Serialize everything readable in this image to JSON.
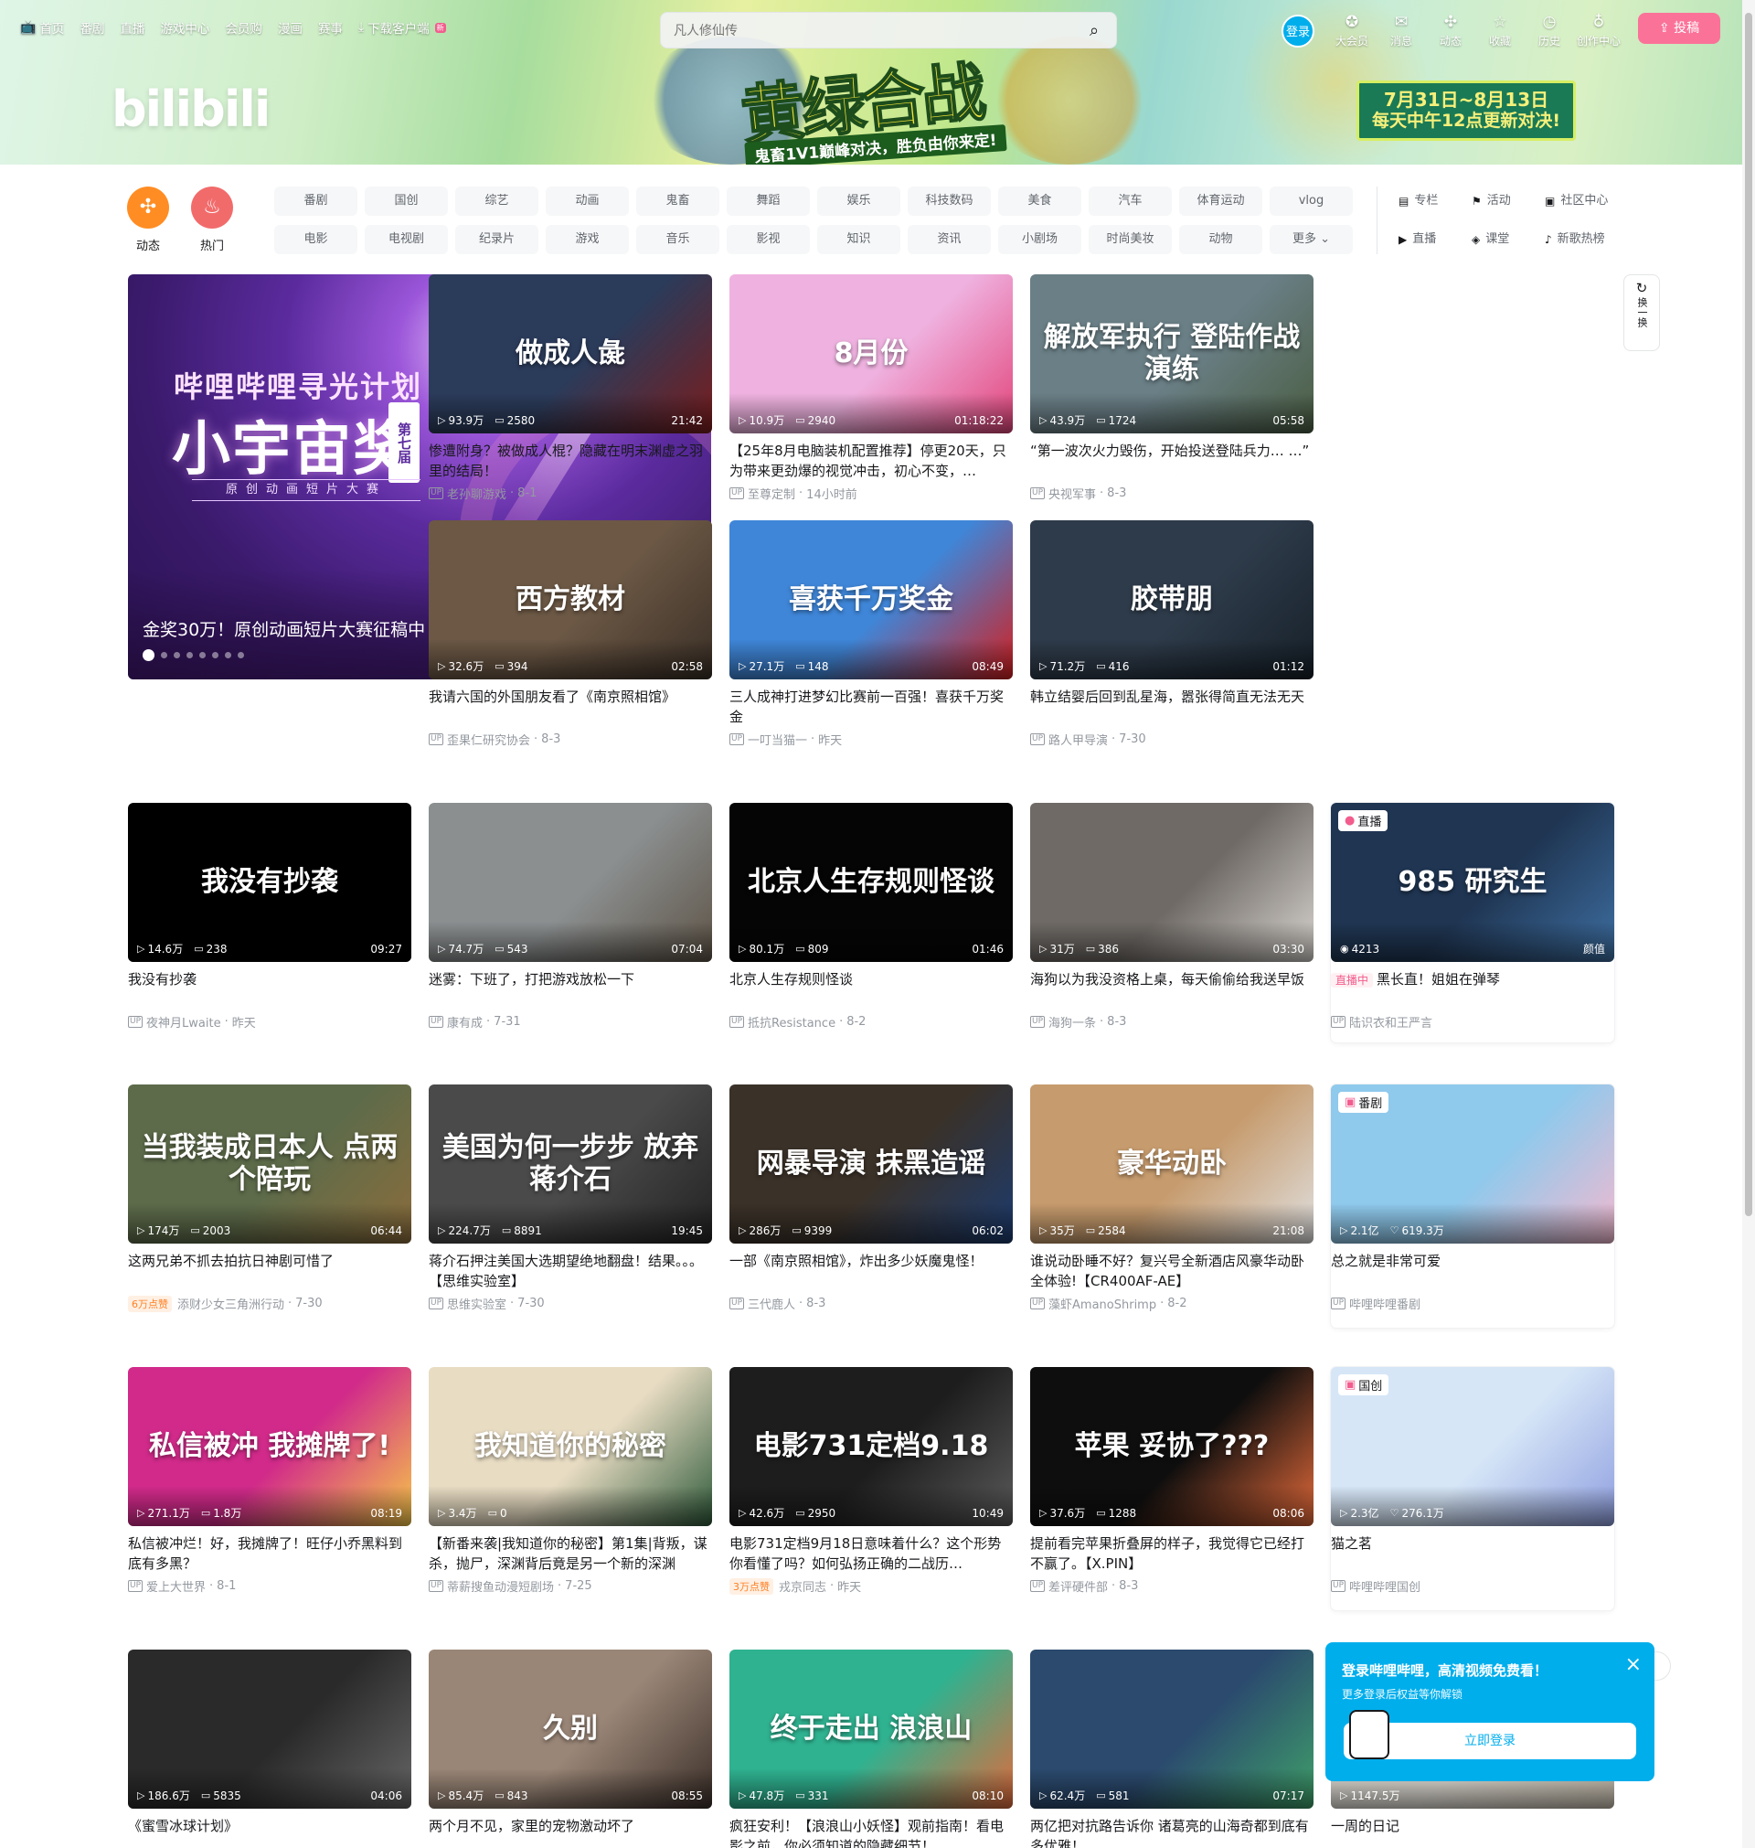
{
  "topnav": [
    {
      "label": "首页",
      "icon": "tv-icon"
    },
    {
      "label": "番剧"
    },
    {
      "label": "直播"
    },
    {
      "label": "游戏中心"
    },
    {
      "label": "会员购"
    },
    {
      "label": "漫画"
    },
    {
      "label": "赛事"
    },
    {
      "label": "下载客户端",
      "icon": "download-icon",
      "badge": "新"
    }
  ],
  "search": {
    "placeholder": "凡人修仙传"
  },
  "login_label": "登录",
  "rightnav": [
    {
      "label": "大会员",
      "icon": "vip-icon"
    },
    {
      "label": "消息",
      "icon": "message-icon"
    },
    {
      "label": "动态",
      "icon": "dynamic-icon"
    },
    {
      "label": "收藏",
      "icon": "star-icon"
    },
    {
      "label": "历史",
      "icon": "clock-icon"
    },
    {
      "label": "创作中心",
      "icon": "bulb-icon"
    }
  ],
  "upload_label": "投稿",
  "banner": {
    "logo": "bilibili",
    "art_title": "黄绿合战",
    "art_sub": "鬼畜1V1巅峰对决，胜负由你来定!",
    "date1": "7月31日~8月13日",
    "date2": "每天中午12点更新对决!"
  },
  "circle_buttons": [
    {
      "label": "动态",
      "color": "#ff8d23"
    },
    {
      "label": "热门",
      "color": "#f26b6b"
    }
  ],
  "channels": [
    "番剧",
    "国创",
    "综艺",
    "动画",
    "鬼畜",
    "舞蹈",
    "娱乐",
    "科技数码",
    "美食",
    "汽车",
    "体育运动",
    "vlog",
    "电影",
    "电视剧",
    "纪录片",
    "游戏",
    "音乐",
    "影视",
    "知识",
    "资讯",
    "小剧场",
    "时尚美妆",
    "动物",
    "更多"
  ],
  "channels_right": [
    {
      "label": "专栏"
    },
    {
      "label": "活动"
    },
    {
      "label": "社区中心"
    },
    {
      "label": "直播"
    },
    {
      "label": "课堂"
    },
    {
      "label": "新歌热榜"
    }
  ],
  "hero": {
    "line1": "哔哩哔哩寻光计划",
    "line2": "小宇宙奖",
    "edition": "第七届",
    "line3": "原创动画短片大赛",
    "caption": "金奖30万！原创动画短片大赛征稿中",
    "dots": 8
  },
  "refresh_label": "换一换",
  "cards": [
    {
      "title": "惨遭附身？被做成人棍？隐藏在明末渊虚之羽里的结局！",
      "views": "93.9万",
      "danmaku": "2580",
      "dur": "21:42",
      "up": "老孙聊游戏",
      "date": "8-1",
      "thumb_text": "做成人彘",
      "bg": "#2b3b5a",
      "accent": "#7a1d1d"
    },
    {
      "title": "【25年8月电脑装机配置推荐】停更20天，只为带来更劲爆的视觉冲击，初心不变，…",
      "views": "10.9万",
      "danmaku": "2940",
      "dur": "01:18:22",
      "up": "至尊定制",
      "date": "14小时前",
      "thumb_text": "8月份",
      "bg": "#efb2e0",
      "accent": "#e2447a"
    },
    {
      "title": "“第一波次火力毁伤，开始投送登陆兵力…\n…”",
      "views": "43.9万",
      "danmaku": "1724",
      "dur": "05:58",
      "up": "央视军事",
      "date": "8-3",
      "thumb_text": "解放军执行 登陆作战演练",
      "bg": "#6a7f86",
      "accent": "#4a5d42"
    },
    {
      "title": "我请六国的外国朋友看了《南京照相馆》",
      "views": "32.6万",
      "danmaku": "394",
      "dur": "02:58",
      "up": "歪果仁研究协会",
      "date": "8-3",
      "thumb_text": "西方教材",
      "bg": "#6c5845",
      "accent": "#3a2f26"
    },
    {
      "title": "三人成神打进梦幻比赛前一百强！喜获千万奖金",
      "views": "27.1万",
      "danmaku": "148",
      "dur": "08:49",
      "up": "一叮当猫一",
      "date": "昨天",
      "thumb_text": "喜获千万奖金",
      "bg": "#3f86d8",
      "accent": "#d41f1f"
    },
    {
      "title": "韩立结婴后回到乱星海，嚣张得简直无法无天",
      "views": "71.2万",
      "danmaku": "416",
      "dur": "01:12",
      "up": "路人甲导演",
      "date": "7-30",
      "thumb_text": "胶带朋",
      "bg": "#2e3b4a",
      "accent": "#162029"
    },
    {
      "title": "我没有抄袭",
      "views": "14.6万",
      "danmaku": "238",
      "dur": "09:27",
      "up": "夜神月Lwaite",
      "date": "昨天",
      "thumb_text": "我没有抄袭",
      "bg": "#000000",
      "accent": "#000000"
    },
    {
      "title": "迷雾：下班了，打把游戏放松一下",
      "views": "74.7万",
      "danmaku": "543",
      "dur": "07:04",
      "up": "康有成",
      "date": "7-31",
      "thumb_text": "",
      "bg": "#8b8f90",
      "accent": "#5e5447"
    },
    {
      "title": "北京人生存规则怪谈",
      "views": "80.1万",
      "danmaku": "809",
      "dur": "01:46",
      "up": "抵抗Resistance",
      "date": "8-2",
      "thumb_text": "北京人生存规则怪谈",
      "bg": "#050505",
      "accent": "#050505"
    },
    {
      "title": "海狗以为我没资格上桌，每天偷偷给我送早饭",
      "views": "31万",
      "danmaku": "386",
      "dur": "03:30",
      "up": "海狗一条",
      "date": "8-3",
      "thumb_text": "",
      "bg": "#6f6a66",
      "accent": "#d8d4cf"
    },
    {
      "title": "黑长直！姐姐在弹琴",
      "views": "4213",
      "danmaku": "",
      "dur": "颜值",
      "up": "陆识衣和王严言",
      "date": "",
      "thumb_text": "985 研究生",
      "bg": "#1f3552",
      "accent": "#3e6fa2",
      "badge": "直播",
      "live": true
    },
    {
      "title": "这两兄弟不抓去拍抗日神剧可惜了",
      "views": "174万",
      "danmaku": "2003",
      "dur": "06:44",
      "up": "添财少女三角洲行动",
      "date": "7-30",
      "thumb_text": "当我装成日本人 点两个陪玩",
      "bg": "#5d6b4a",
      "accent": "#8b6d3c",
      "hot": "6万点赞"
    },
    {
      "title": "蒋介石押注美国大选期望绝地翻盘！结果。。。【思维实验室】",
      "views": "224.7万",
      "danmaku": "8891",
      "dur": "19:45",
      "up": "思维实验室",
      "date": "7-30",
      "thumb_text": "美国为何一步步 放弃蒋介石",
      "bg": "#4a4a4a",
      "accent": "#222222"
    },
    {
      "title": "一部《南京照相馆》，炸出多少妖魔鬼怪！",
      "views": "286万",
      "danmaku": "9399",
      "dur": "06:02",
      "up": "三代鹿人",
      "date": "8-3",
      "thumb_text": "网暴导演 抹黑造谣",
      "bg": "#3a3128",
      "accent": "#1c3b6e"
    },
    {
      "title": "谁说动卧睡不好？复兴号全新酒店风豪华动卧全体验!【CR400AF-AE】",
      "views": "35万",
      "danmaku": "2584",
      "dur": "21:08",
      "up": "藻虾AmanoShrimp",
      "date": "8-2",
      "thumb_text": "豪华动卧",
      "bg": "#c69b6d",
      "accent": "#e0e0e0"
    },
    {
      "title": "总之就是非常可爱",
      "views": "2.1亿",
      "danmaku": "619.3万",
      "dur": "",
      "up": "哔哩哔哩番剧",
      "date": "",
      "thumb_text": "",
      "bg": "#8fc9ec",
      "accent": "#f3b9cf",
      "badge": "番剧",
      "like": true
    },
    {
      "title": "私信被冲烂！好，我摊牌了！旺仔小乔黑料到底有多黑？",
      "views": "271.1万",
      "danmaku": "1.8万",
      "dur": "08:19",
      "up": "爱上大世界",
      "date": "8-1",
      "thumb_text": "私信被冲 我摊牌了!",
      "bg": "#d12a8a",
      "accent": "#f7c948"
    },
    {
      "title": "【新番来袭|我知道你的秘密】第1集|背叛，谋杀，抛尸，深渊背后竟是另一个新的深渊",
      "views": "3.4万",
      "danmaku": "0",
      "dur": "",
      "up": "蒂薪搜鱼动漫短剧场",
      "date": "7-25",
      "thumb_text": "我知道你的秘密",
      "bg": "#e8dcc3",
      "accent": "#2f5a3a"
    },
    {
      "title": "电影731定档9月18日意味着什么？这个形势你看懂了吗？如何弘扬正确的二战历…",
      "views": "42.6万",
      "danmaku": "2950",
      "dur": "10:49",
      "up": "戎京同志",
      "date": "昨天",
      "thumb_text": "电影731定档9.18",
      "bg": "#1d1d1d",
      "accent": "#5a5a5a",
      "hot": "3万点赞"
    },
    {
      "title": "提前看完苹果折叠屏的样子，我觉得它已经打不赢了。【X.PIN】",
      "views": "37.6万",
      "danmaku": "1288",
      "dur": "08:06",
      "up": "差评硬件部",
      "date": "8-3",
      "thumb_text": "苹果 妥协了???",
      "bg": "#0e0e0e",
      "accent": "#e46a3a"
    },
    {
      "title": "猫之茗",
      "views": "2.3亿",
      "danmaku": "276.1万",
      "dur": "",
      "up": "哔哩哔哩国创",
      "date": "",
      "thumb_text": "",
      "bg": "#d6e6f7",
      "accent": "#8f9fe0",
      "badge": "国创",
      "like": true
    },
    {
      "title": "《蜜雪冰球计划》",
      "views": "186.6万",
      "danmaku": "5835",
      "dur": "04:06",
      "up": "",
      "date": "",
      "thumb_text": "",
      "bg": "#2a2a2a",
      "accent": "#666666"
    },
    {
      "title": "两个月不见，家里的宠物激动坏了",
      "views": "85.4万",
      "danmaku": "843",
      "dur": "08:55",
      "up": "",
      "date": "",
      "thumb_text": "久别",
      "bg": "#9a8677",
      "accent": "#3b2f29"
    },
    {
      "title": "疯狂安利！【浪浪山小妖怪】观前指南！看电影之前，你必须知道的隐藏细节！",
      "views": "47.8万",
      "danmaku": "331",
      "dur": "08:10",
      "up": "",
      "date": "",
      "thumb_text": "终于走出 浪浪山",
      "bg": "#2fb290",
      "accent": "#e26a3b"
    },
    {
      "title": "两亿把对抗路告诉你 诸葛亮的山海奇都到底有多优雅！",
      "views": "62.4万",
      "danmaku": "581",
      "dur": "07:17",
      "up": "",
      "date": "",
      "thumb_text": "",
      "bg": "#2b4a6e",
      "accent": "#3fa06a"
    },
    {
      "title": "一周的日记",
      "views": "1147.5万",
      "danmaku": "",
      "dur": "",
      "up": "",
      "date": "",
      "thumb_text": "",
      "bg": "#e8e4dc",
      "accent": "#c9c0b0"
    }
  ],
  "popup": {
    "title": "登录哔哩哔哩，高清视频免费看！",
    "sub": "更多登录后权益等你解锁",
    "button": "立即登录"
  }
}
